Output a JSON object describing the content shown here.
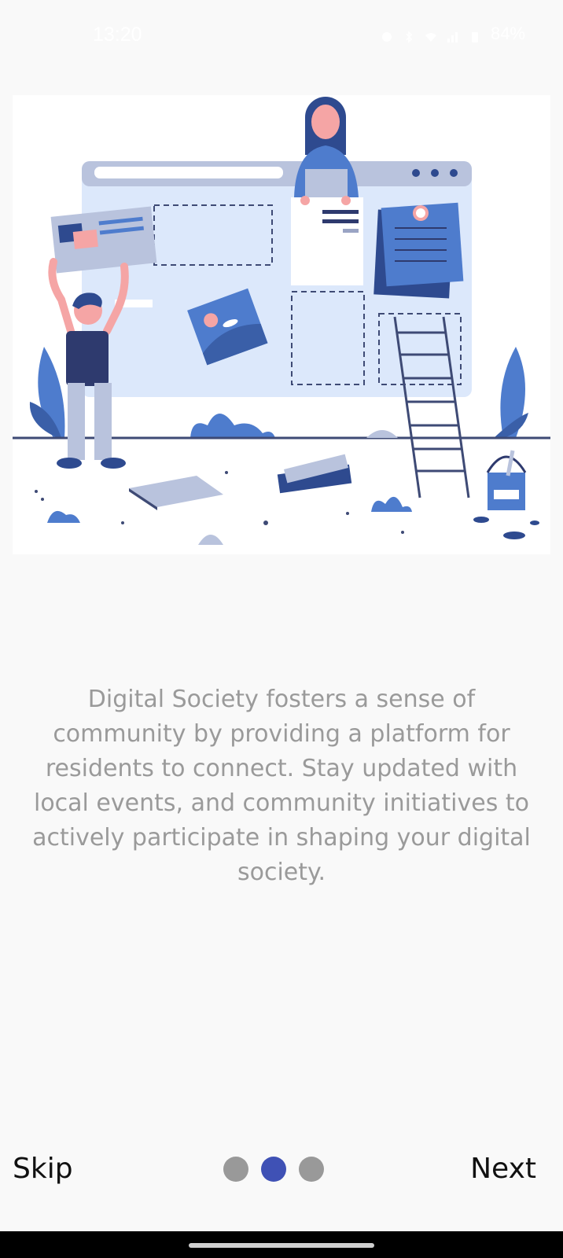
{
  "status_bar": {
    "time": "13:20",
    "battery": "84%",
    "icons": [
      "notification-icon",
      "bluetooth-icon",
      "wifi-icon",
      "signal-icon",
      "battery-icon"
    ]
  },
  "illustration": {
    "description": "onboarding-community-illustration"
  },
  "onboarding": {
    "description": "Digital Society fosters a sense of community by providing a platform for residents to connect. Stay updated with local events, and community initiatives to actively participate in shaping your digital society.",
    "current_page": 2,
    "total_pages": 3
  },
  "controls": {
    "skip_label": "Skip",
    "next_label": "Next"
  },
  "colors": {
    "accent": "#3f51b5",
    "inactive_dot": "#999999",
    "text_secondary": "#9a9a9a",
    "background": "#f9f9f9"
  }
}
